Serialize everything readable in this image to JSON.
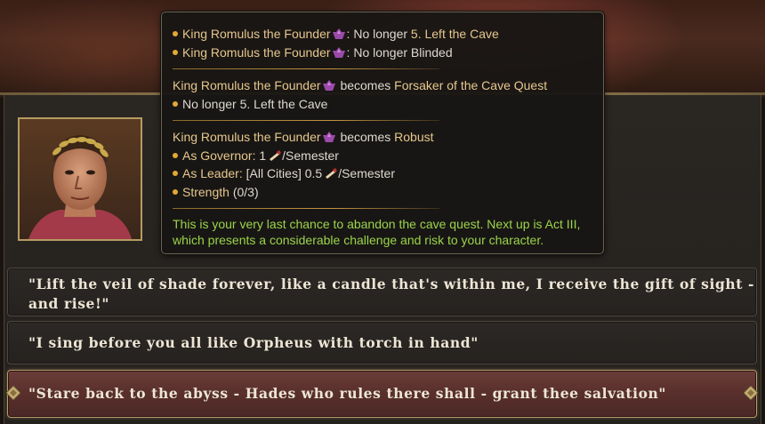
{
  "tooltip": {
    "lines": [
      {
        "name": "King Romulus the Founder",
        "sep": ":",
        "text": " No longer ",
        "highlight": "5. Left the Cave"
      },
      {
        "name": "King Romulus the Founder",
        "sep": ":",
        "text": " No longer Blinded"
      }
    ],
    "section2": {
      "name": "King Romulus the Founder",
      "verb": "becomes",
      "trait": "Forsaker of the Cave Quest",
      "bullet": "No longer 5. Left the Cave"
    },
    "section3": {
      "name": "King Romulus the Founder",
      "verb": "becomes",
      "trait": "Robust",
      "governor_label": "As Governor:",
      "governor_value": "1",
      "governor_unit": "/Semester",
      "leader_label": "As Leader:",
      "leader_value": "[All Cities] 0.5",
      "leader_unit": "/Semester",
      "strength_label": "Strength",
      "strength_value": "(0/3)"
    },
    "note": "This is your very last chance to abandon the cave quest. Next up is Act III, which presents a considerable challenge and risk to your character."
  },
  "choices": [
    {
      "label": "\"Lift the veil of shade forever, like a candle that's within me, I receive the gift of sight - and rise!\""
    },
    {
      "label": "\"I sing before you all like Orpheus with torch in hand\""
    },
    {
      "label": "\"Stare back to the abyss - Hades who rules there shall - grant thee salvation\"",
      "selected": true
    }
  ],
  "icons": {
    "character_gem": "character-gem-icon",
    "scroll": "scroll-icon",
    "bullet": "bullet-dot-icon"
  },
  "colors": {
    "gold_text": "#e6c78d",
    "green_note": "#9bd44a",
    "bullet": "#e3a935",
    "selected_choice": "#5a302d"
  }
}
